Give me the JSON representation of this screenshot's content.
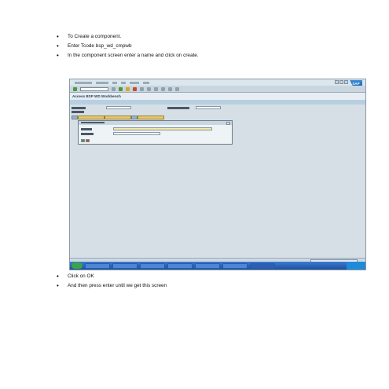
{
  "intro_steps": [
    "To  Create  a component.",
    "Enter  Tcode bsp_wd_cmpwb",
    "In the component screen enter a name and click on create."
  ],
  "followup_steps": [
    "Click on OK",
    "And then press enter until we get this screen"
  ],
  "screenshot": {
    "title": "Access BSP WD Workbench",
    "logo": "SAP"
  }
}
